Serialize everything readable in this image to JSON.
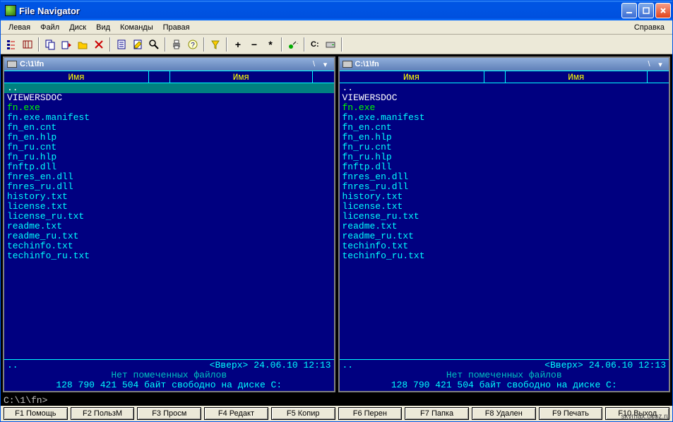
{
  "window": {
    "title": "File Navigator"
  },
  "menu": {
    "left": "Левая",
    "file": "Файл",
    "disk": "Диск",
    "view": "Вид",
    "commands": "Команды",
    "right": "Правая",
    "help": "Справка"
  },
  "toolbar": {
    "drive_label": "C:"
  },
  "panels": {
    "left": {
      "path": "C:\\1\\fn",
      "drop_left": "\\",
      "drop_right": "▾",
      "col1": "Имя",
      "col2": "Имя",
      "files": [
        {
          "name": "..",
          "cls": "dir"
        },
        {
          "name": "VIEWERSDOC",
          "cls": "dir"
        },
        {
          "name": "fn.exe",
          "cls": "exe"
        },
        {
          "name": "fn.exe.manifest",
          "cls": "txt"
        },
        {
          "name": "fn_en.cnt",
          "cls": "txt"
        },
        {
          "name": "fn_en.hlp",
          "cls": "txt"
        },
        {
          "name": "fn_ru.cnt",
          "cls": "txt"
        },
        {
          "name": "fn_ru.hlp",
          "cls": "txt"
        },
        {
          "name": "fnftp.dll",
          "cls": "txt"
        },
        {
          "name": "fnres_en.dll",
          "cls": "txt"
        },
        {
          "name": "fnres_ru.dll",
          "cls": "txt"
        },
        {
          "name": "history.txt",
          "cls": "txt"
        },
        {
          "name": "license.txt",
          "cls": "txt"
        },
        {
          "name": "license_ru.txt",
          "cls": "txt"
        },
        {
          "name": "readme.txt",
          "cls": "txt"
        },
        {
          "name": "readme_ru.txt",
          "cls": "txt"
        },
        {
          "name": "techinfo.txt",
          "cls": "txt"
        },
        {
          "name": "techinfo_ru.txt",
          "cls": "txt"
        }
      ],
      "selected_index": 0,
      "foot_left": "..",
      "foot_mid": "<Вверх>",
      "foot_date": "24.06.10 12:13",
      "foot_marked": "Нет помеченных файлов",
      "foot_free": "128 790 421 504 байт свободно на диске C:"
    },
    "right": {
      "path": "C:\\1\\fn",
      "drop_left": "\\",
      "drop_right": "▾",
      "col1": "Имя",
      "col2": "Имя",
      "files": [
        {
          "name": "..",
          "cls": "dir"
        },
        {
          "name": "VIEWERSDOC",
          "cls": "dir"
        },
        {
          "name": "fn.exe",
          "cls": "exe"
        },
        {
          "name": "fn.exe.manifest",
          "cls": "txt"
        },
        {
          "name": "fn_en.cnt",
          "cls": "txt"
        },
        {
          "name": "fn_en.hlp",
          "cls": "txt"
        },
        {
          "name": "fn_ru.cnt",
          "cls": "txt"
        },
        {
          "name": "fn_ru.hlp",
          "cls": "txt"
        },
        {
          "name": "fnftp.dll",
          "cls": "txt"
        },
        {
          "name": "fnres_en.dll",
          "cls": "txt"
        },
        {
          "name": "fnres_ru.dll",
          "cls": "txt"
        },
        {
          "name": "history.txt",
          "cls": "txt"
        },
        {
          "name": "license.txt",
          "cls": "txt"
        },
        {
          "name": "license_ru.txt",
          "cls": "txt"
        },
        {
          "name": "readme.txt",
          "cls": "txt"
        },
        {
          "name": "readme_ru.txt",
          "cls": "txt"
        },
        {
          "name": "techinfo.txt",
          "cls": "txt"
        },
        {
          "name": "techinfo_ru.txt",
          "cls": "txt"
        }
      ],
      "selected_index": -1,
      "foot_left": "..",
      "foot_mid": "<Вверх>",
      "foot_date": "24.06.10 12:13",
      "foot_marked": "Нет помеченных файлов",
      "foot_free": "128 790 421 504 байт свободно на диске C:"
    }
  },
  "cmdline": {
    "prompt": "C:\\1\\fn>"
  },
  "fkeys": [
    "F1 Помощь",
    "F2 ПользМ",
    "F3 Просм",
    "F4 Редакт",
    "F5 Копир",
    "F6 Перен",
    "F7 Папка",
    "F8 Удален",
    "F9 Печать",
    "F10 Выход"
  ],
  "watermark": "skymax.ucoz.ru"
}
